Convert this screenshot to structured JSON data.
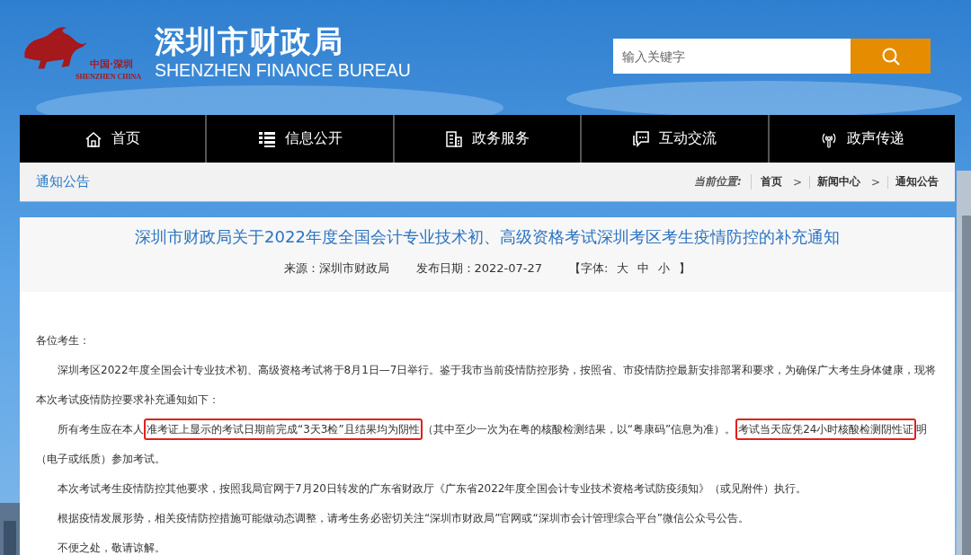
{
  "header": {
    "logo_cn": "中国·深圳",
    "logo_en": "SHENZHEN CHINA",
    "title": "深圳市财政局",
    "subtitle": "SHENZHEN FINANCE BUREAU",
    "search": {
      "placeholder": "输入关键字"
    }
  },
  "nav": [
    {
      "label": "首页"
    },
    {
      "label": "信息公开"
    },
    {
      "label": "政务服务"
    },
    {
      "label": "互动交流"
    },
    {
      "label": "政声传递"
    }
  ],
  "section": {
    "title": "通知公告",
    "breadcrumb_label": "当前位置:",
    "separator": ">",
    "breadcrumb": [
      "首页",
      "新闻中心",
      "通知公告"
    ]
  },
  "article": {
    "title": "深圳市财政局关于2022年度全国会计专业技术初、高级资格考试深圳考区考生疫情防控的补充通知",
    "source": "来源：深圳市财政局",
    "date": "发布日期：2022-07-27",
    "font_label": "【字体:",
    "font_sizes": [
      "大",
      "中",
      "小"
    ],
    "font_end": "】",
    "paragraphs": [
      {
        "indent": false,
        "segments": [
          {
            "text": "各位考生：",
            "highlighted": false
          }
        ]
      },
      {
        "indent": true,
        "segments": [
          {
            "text": "深圳考区2022年度全国会计专业技术初、高级资格考试将于8月1日—7日举行。鉴于我市当前疫情防控形势，按照省、市疫情防控最新安排部署和要求，为确保广大考生身体健康，现将本次考试疫情防控要求补充通知如下：",
            "highlighted": false
          }
        ]
      },
      {
        "indent": true,
        "segments": [
          {
            "text": "所有考生应在本人",
            "highlighted": false
          },
          {
            "text": "准考证上显示的考试日期前完成“3天3检”且结果均为阴性",
            "highlighted": true
          },
          {
            "text": "（其中至少一次为在粤的核酸检测结果，以“粤康码”信息为准）。",
            "highlighted": false
          },
          {
            "text": "考试当天应凭24小时核酸检测阴性证",
            "highlighted": true
          },
          {
            "text": "明（电子或纸质）参加考试。",
            "highlighted": false
          }
        ]
      },
      {
        "indent": true,
        "segments": [
          {
            "text": "本次考试考生疫情防控其他要求，按照我局官网于7月20日转发的广东省财政厅《广东省2022年度全国会计专业技术资格考试防疫须知》（或见附件）执行。",
            "highlighted": false
          }
        ]
      },
      {
        "indent": true,
        "segments": [
          {
            "text": "根据疫情发展形势，相关疫情防控措施可能做动态调整，请考生务必密切关注“深圳市财政局”官网或“深圳市会计管理综合平台”微信公众号公告。",
            "highlighted": false
          }
        ]
      },
      {
        "indent": true,
        "segments": [
          {
            "text": "不便之处，敬请谅解。",
            "highlighted": false
          }
        ]
      }
    ]
  }
}
